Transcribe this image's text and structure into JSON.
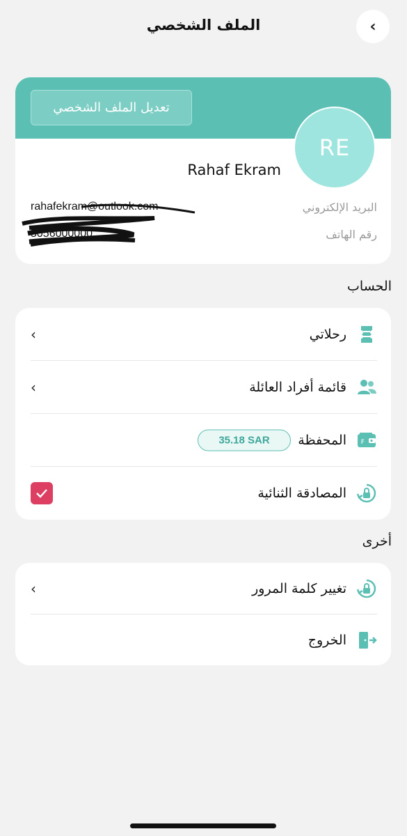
{
  "header": {
    "title": "الملف الشخصي",
    "back_icon": "chevron-left-icon"
  },
  "profile": {
    "edit_label": "تعديل الملف الشخصي",
    "initials": "RE",
    "name": "Rahaf Ekram",
    "email_label": "البريد الإلكتروني",
    "email_value": "rahafekram@outlook.com",
    "phone_label": "رقم الهاتف",
    "phone_value": "5056000000"
  },
  "sections": {
    "account_title": "الحساب",
    "other_title": "أخرى"
  },
  "account_items": [
    {
      "label": "رحلاتي",
      "icon": "ticket-icon"
    },
    {
      "label": "قائمة أفراد العائلة",
      "icon": "users-icon"
    },
    {
      "label": "المحفظة",
      "icon": "wallet-icon",
      "badge": "35.18 SAR"
    },
    {
      "label": "المصادقة الثنائية",
      "icon": "lock-refresh-icon",
      "checked": true
    }
  ],
  "other_items": [
    {
      "label": "تغيير كلمة المرور",
      "icon": "lock-refresh-icon"
    },
    {
      "label": "الخروج",
      "icon": "logout-icon"
    }
  ],
  "colors": {
    "accent": "#5bbfb4",
    "avatar": "#9fe5df",
    "checkbox": "#dd3f63",
    "background": "#f2f2f2"
  }
}
